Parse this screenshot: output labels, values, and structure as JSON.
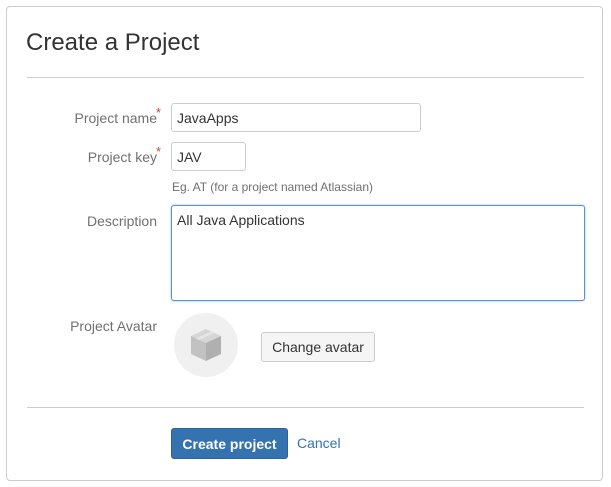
{
  "dialog": {
    "title": "Create a Project"
  },
  "form": {
    "project_name": {
      "label": "Project name",
      "required_marker": "*",
      "value": "JavaApps"
    },
    "project_key": {
      "label": "Project key",
      "required_marker": "*",
      "value": "JAV",
      "hint": "Eg. AT (for a project named Atlassian)"
    },
    "description": {
      "label": "Description",
      "value": "All Java Applications"
    },
    "avatar": {
      "label": "Project Avatar",
      "icon": "box-icon",
      "change_label": "Change avatar"
    }
  },
  "actions": {
    "submit_label": "Create project",
    "cancel_label": "Cancel"
  },
  "colors": {
    "primary": "#3572b0",
    "required": "#d04437",
    "focus_border": "#5b8fd6"
  }
}
